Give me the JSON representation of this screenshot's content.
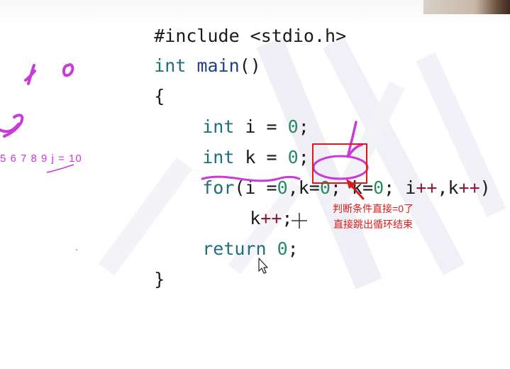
{
  "code": {
    "line1": "#include <stdio.h>",
    "line2": {
      "kw": "int",
      "fn": "main",
      "rest": "()"
    },
    "line3": "{",
    "line4": {
      "kw": "int",
      "rest": " i = ",
      "num": "0",
      "end": ";"
    },
    "line5": {
      "kw": "int",
      "rest": " k = ",
      "num": "0",
      "end": ";"
    },
    "line6": {
      "kw": "for",
      "p1": "(i =",
      "n1": "0",
      "p2": ",k=",
      "n2": "0",
      "p3": "; k=",
      "n3": "0",
      "p4": "; i",
      "op1": "++",
      "p5": ",k",
      "op2": "++",
      "p6": ")"
    },
    "line7": {
      "rest": "k",
      "op": "++",
      "end": ";"
    },
    "line8": {
      "kw": "return",
      "num": "0",
      "end": ";"
    },
    "line9": "}"
  },
  "annotations": {
    "left_sequence": "5 6 7 8 9  j = 10",
    "callout_line1": "判断条件直接=0了",
    "callout_line2": "直接跳出循环结束"
  },
  "colors": {
    "keyword": "#1f6f7a",
    "function": "#1e3d8f",
    "number": "#2a8a63",
    "operator": "#8a1f3a",
    "pen": "#c23bd3",
    "callout_red": "#d81b1b"
  },
  "icons": {
    "cursor": "mouse-pointer-icon",
    "crosshair": "crosshair-icon"
  }
}
